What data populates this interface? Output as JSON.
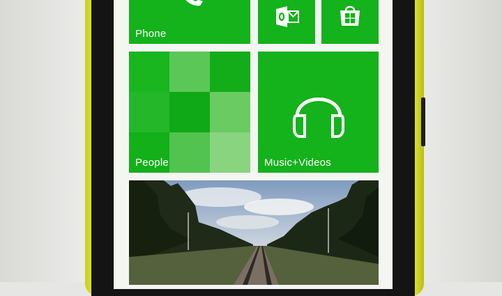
{
  "start_screen": {
    "tiles": [
      {
        "label": "Phone",
        "icon": "phone-handset-icon"
      },
      {
        "label": "",
        "icon": "office-outlook-icon"
      },
      {
        "label": "",
        "icon": "store-bag-icon"
      },
      {
        "label": "People",
        "icon": "people-mosaic"
      },
      {
        "label": "Music+Videos",
        "icon": "headphones-icon"
      },
      {
        "label": "",
        "icon": "railroad-photo"
      }
    ],
    "people_mosaic_shades": [
      "#19b620",
      "#5bc757",
      "#13ad1a",
      "#23b729",
      "#0fa816",
      "#6acb63",
      "#13b01a",
      "#52c34e",
      "#88d47f"
    ]
  },
  "colors": {
    "tile_green": "#14b21b",
    "case_yellow": "#dfe22a",
    "bezel": "#141414"
  }
}
